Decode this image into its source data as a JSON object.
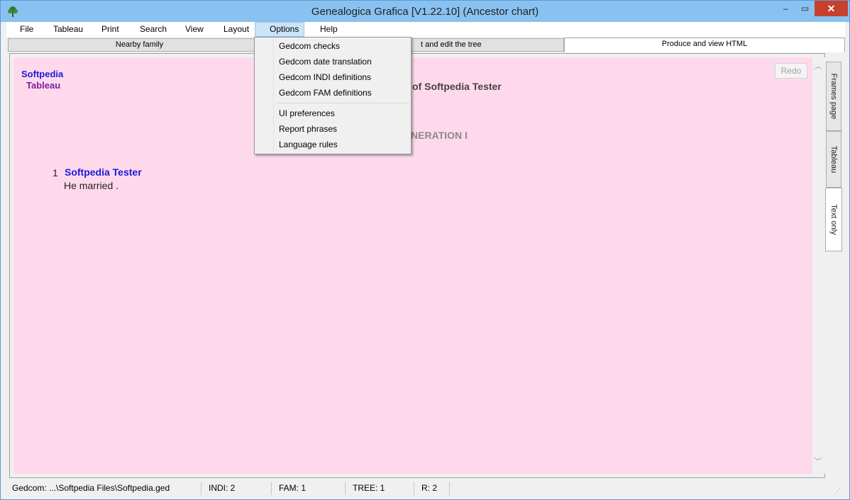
{
  "window": {
    "title": "Genealogica Grafica  [V1.22.10]   (Ancestor chart)",
    "controls": {
      "minimize": "–",
      "maximize": "▭",
      "close": "✕"
    }
  },
  "menubar": {
    "items": [
      "File",
      "Tableau",
      "Print",
      "Search",
      "View",
      "Layout",
      "Options",
      "Help"
    ],
    "active": "Options"
  },
  "tabs": [
    {
      "label": "Nearby family"
    },
    {
      "label": "t and edit the tree"
    },
    {
      "label": "Produce and view HTML",
      "selected": true
    }
  ],
  "options_menu": {
    "group1": [
      "Gedcom checks",
      "Gedcom date translation",
      "Gedcom INDI definitions",
      "Gedcom FAM definitions"
    ],
    "group2": [
      "UI preferences",
      "Report phrases",
      "Language rules"
    ]
  },
  "content": {
    "corner_line1": "Softpedia",
    "corner_line2": "Tableau",
    "heading": "of Softpedia Tester",
    "generation": "NERATION I",
    "person": {
      "number": "1",
      "name": "Softpedia Tester",
      "note": "He married ."
    },
    "redo_label": "Redo"
  },
  "side_tabs": [
    {
      "label": "Frames page"
    },
    {
      "label": "Tableau"
    },
    {
      "label": "Text only",
      "selected": true
    }
  ],
  "statusbar": {
    "gedcom": "Gedcom: ...\\Softpedia Files\\Softpedia.ged",
    "indi": "INDI:  2",
    "fam": "FAM:  1",
    "tree": "TREE:  1",
    "r": "R:  2"
  },
  "colors": {
    "titlebar": "#89c2f0",
    "content_bg": "#fed9ec",
    "link_blue": "#1a1ad8",
    "purple": "#7b1fa2",
    "close_button": "#c7402d"
  },
  "icons": {
    "app": "tree-icon",
    "scroll_up": "chevron-up-icon",
    "scroll_down": "chevron-down-icon",
    "size_grip": "size-grip-icon"
  }
}
